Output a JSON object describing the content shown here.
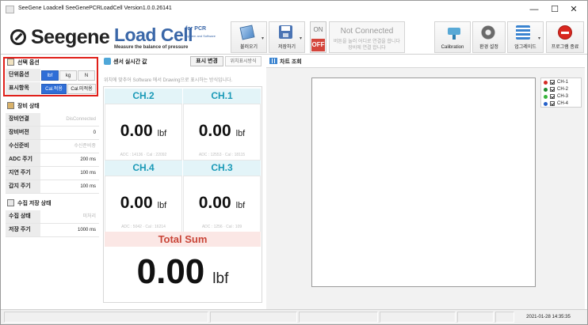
{
  "window": {
    "title": "SeeGene Loadcell SeeGenePCRLoadCell Version1.0.0.26141",
    "minimize_glyph": "—",
    "maximize_glyph": "☐",
    "close_glyph": "✕"
  },
  "brand": {
    "name": "Seegene",
    "product": "Load Cell",
    "for_text": "for PCR",
    "system_text": "System and Software",
    "tagline": "Measure the balance of pressure"
  },
  "toolbar": {
    "load_label": "불러오기",
    "save_label": "저장하기",
    "on_label": "ON",
    "off_label": "OFF",
    "connection_status": "Not Connected",
    "connection_hint_line1": "버튼을 눌러 어디로 연결을 합니다",
    "connection_hint_line2": "장비에 연결 합니다",
    "calibration_label": "Calibration",
    "settings_label": "환경 설정",
    "upgrade_label": "업그레이드",
    "exit_label": "프로그램 종료"
  },
  "options": {
    "header": "선택 옵션",
    "unit_label": "단위옵션",
    "units": [
      "lbf",
      "kg",
      "N"
    ],
    "selected_unit": "lbf",
    "display_label": "표시항목",
    "display_items": [
      "Cal.적용",
      "Cal.미적용"
    ],
    "selected_display": "Cal.적용"
  },
  "device": {
    "header": "장비 상태",
    "rows": [
      {
        "label": "장비연결",
        "value": "DisConnected",
        "dim": true
      },
      {
        "label": "장비버전",
        "value": "0",
        "dim": false
      },
      {
        "label": "수신준비",
        "value": "수신준비중",
        "dim": true
      },
      {
        "label": "ADC  주기",
        "value": "200 ms",
        "dim": false
      },
      {
        "label": "지연  주기",
        "value": "100 ms",
        "dim": false
      },
      {
        "label": "갑지  주기",
        "value": "100 ms",
        "dim": false
      }
    ]
  },
  "collect": {
    "header": "수집 저장 상태",
    "rows": [
      {
        "label": "수집 상태",
        "value": "미처리",
        "dim": true
      },
      {
        "label": "저장 주기",
        "value": "1000 ms",
        "dim": false
      }
    ]
  },
  "sensor": {
    "header": "센서 실시간 값",
    "display_change_label": "표시 변경",
    "position_label": "위치표시방식",
    "description": "위치에 맞추어 Software 에서 Drawing으로 표시하는 방식입니다.",
    "channels": [
      {
        "name": "CH.2",
        "value": "0.00",
        "unit": "lbf",
        "adc": "ADC : 14136 · Cal : 22092"
      },
      {
        "name": "CH.1",
        "value": "0.00",
        "unit": "lbf",
        "adc": "ADC : 12553 · Cal : 18115"
      },
      {
        "name": "CH.4",
        "value": "0.00",
        "unit": "lbf",
        "adc": "ADC : 5042 · Cal : 16214"
      },
      {
        "name": "CH.3",
        "value": "0.00",
        "unit": "lbf",
        "adc": "ADC : 1256 · Cal : 109"
      }
    ],
    "total_label": "Total Sum",
    "total_value": "0.00",
    "total_unit": "lbf"
  },
  "chart": {
    "tab_label": "차트 조회",
    "legend": [
      {
        "name": "CH-1",
        "color": "#d42b24"
      },
      {
        "name": "CH-2",
        "color": "#1f8a2e"
      },
      {
        "name": "CH-3",
        "color": "#36b53b"
      },
      {
        "name": "CH-4",
        "color": "#2560c8"
      }
    ]
  },
  "status": {
    "datetime": "2021-01-28 14:35:35"
  }
}
